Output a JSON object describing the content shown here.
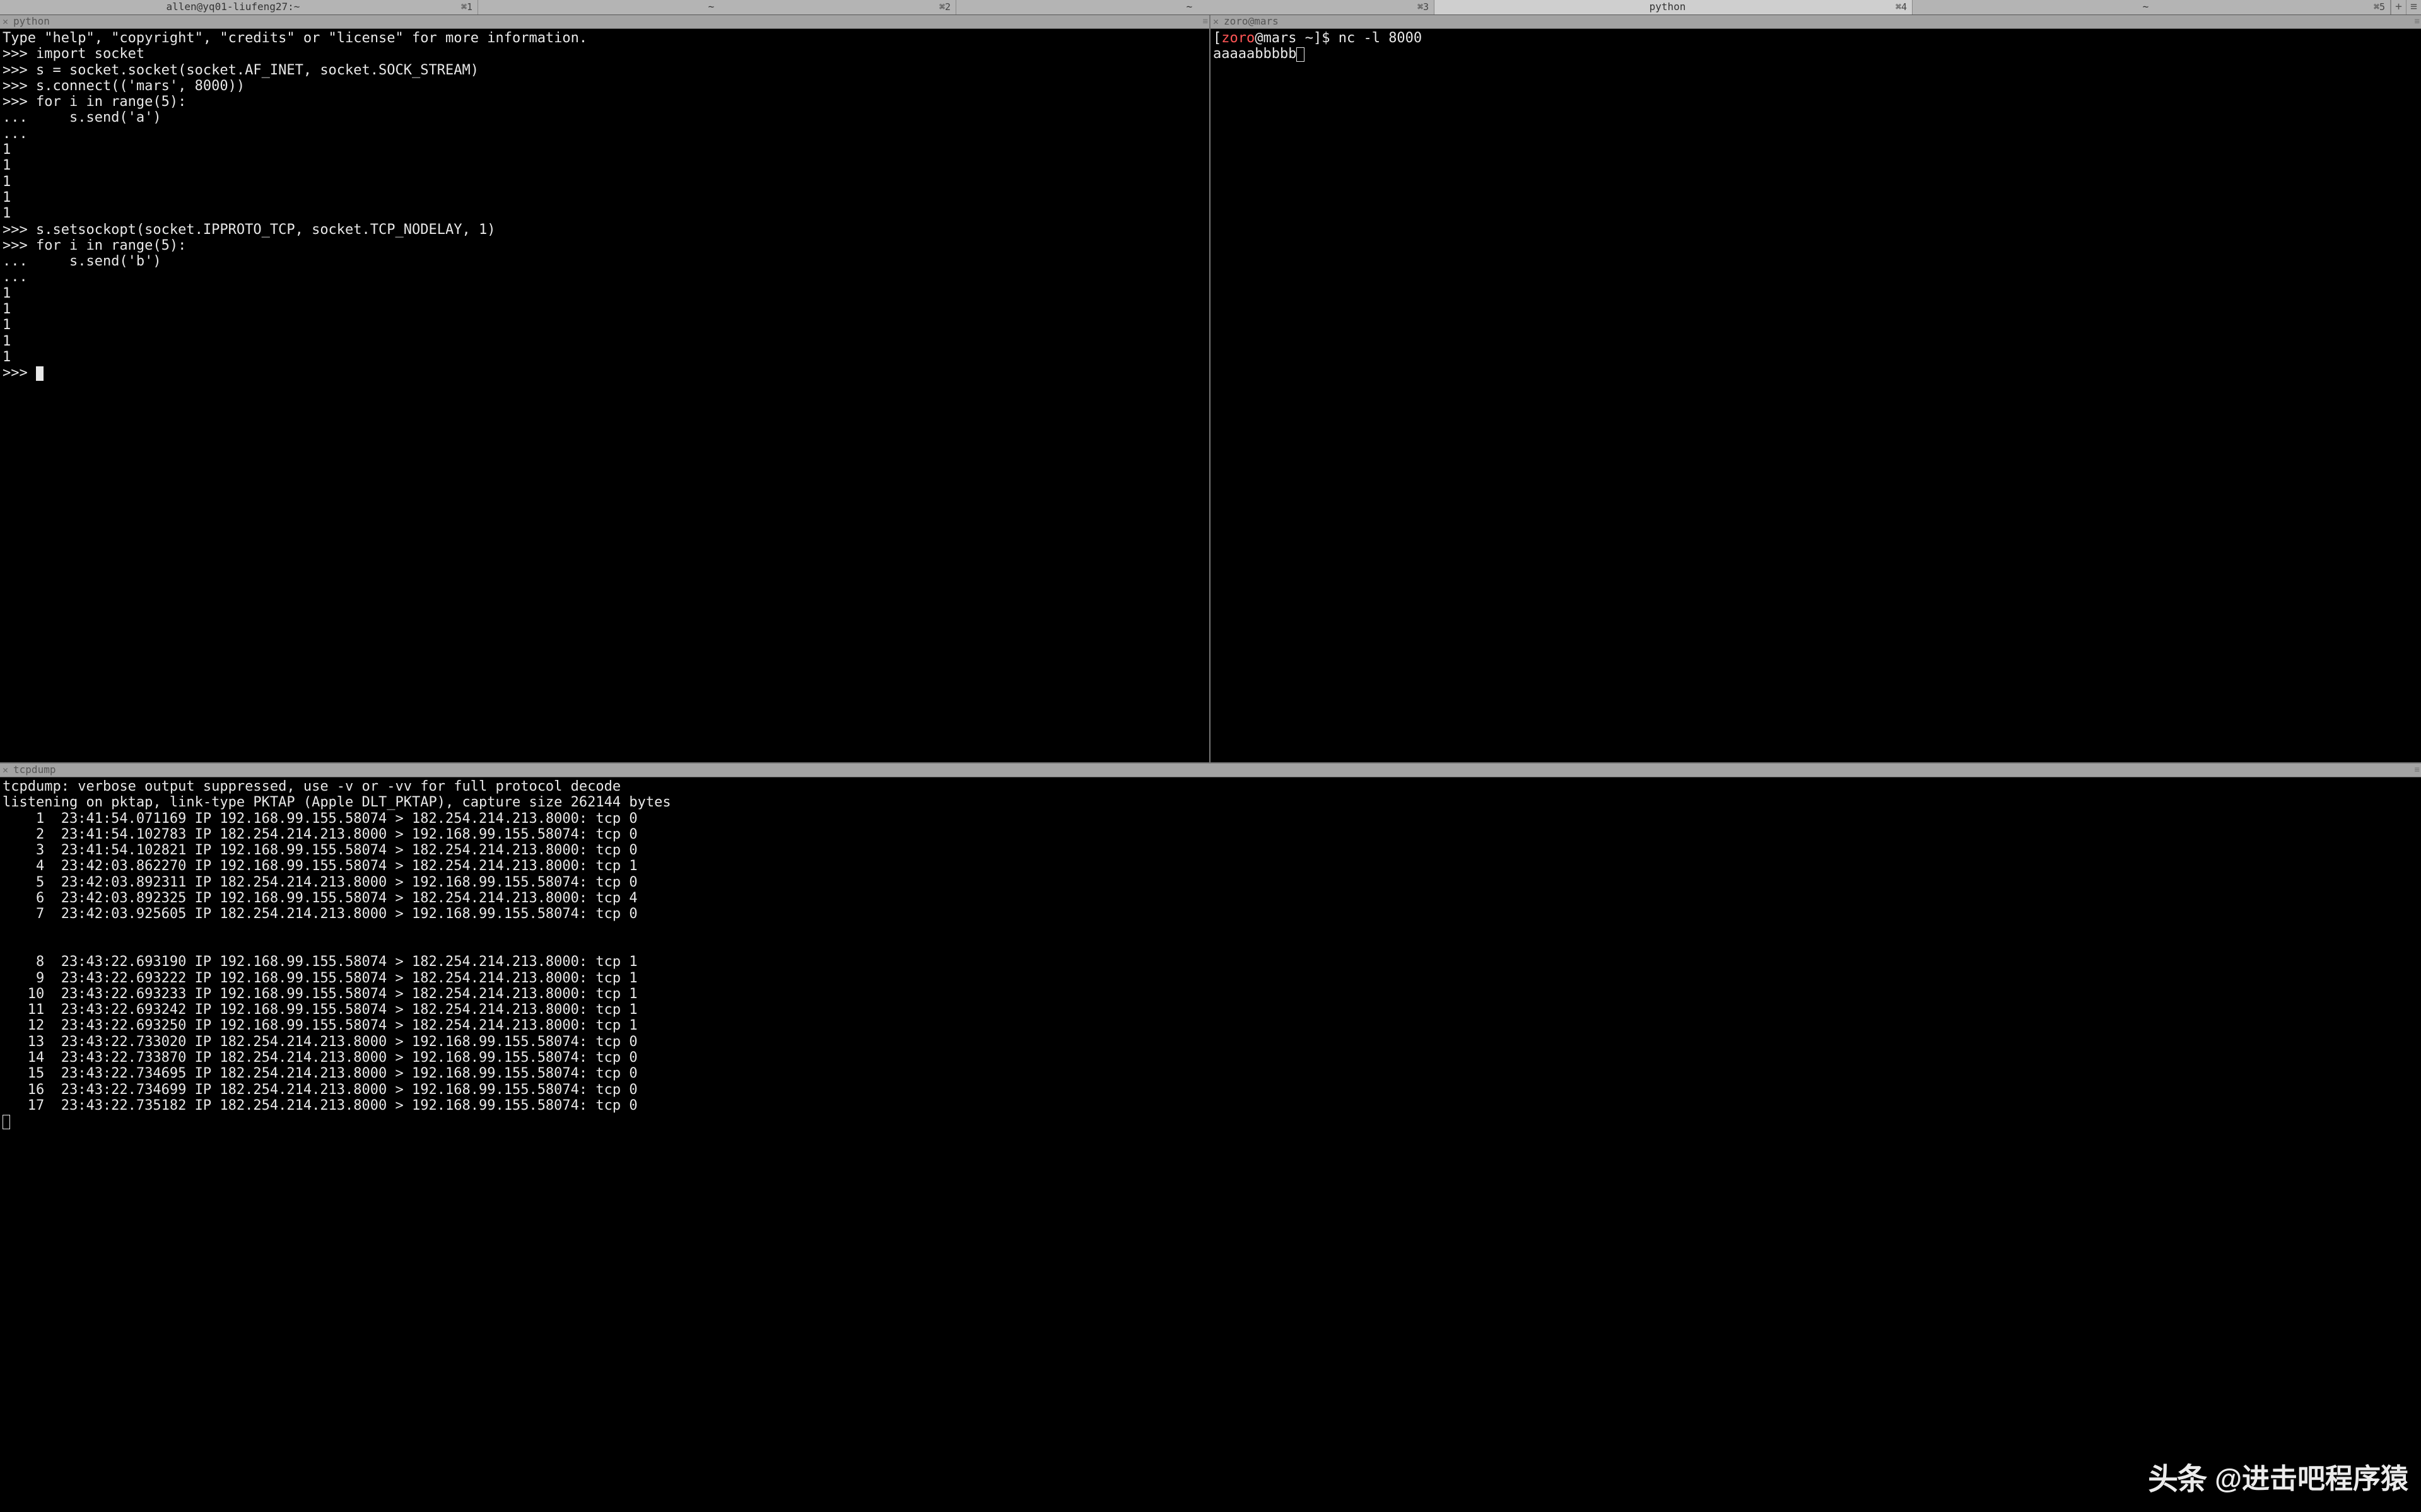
{
  "global_tabs": [
    {
      "title": "allen@yq01-liufeng27:~",
      "shortcut": "⌘1",
      "active": false
    },
    {
      "title": "~",
      "shortcut": "⌘2",
      "active": false
    },
    {
      "title": "~",
      "shortcut": "⌘3",
      "active": false
    },
    {
      "title": "python",
      "shortcut": "⌘4",
      "active": true
    },
    {
      "title": "~",
      "shortcut": "⌘5",
      "active": false
    }
  ],
  "pane_left": {
    "header_label": "python",
    "lines": [
      "Type \"help\", \"copyright\", \"credits\" or \"license\" for more information.",
      ">>> import socket",
      ">>> s = socket.socket(socket.AF_INET, socket.SOCK_STREAM)",
      ">>> s.connect(('mars', 8000))",
      ">>> for i in range(5):",
      "...     s.send('a')",
      "... ",
      "1",
      "1",
      "1",
      "1",
      "1",
      ">>> s.setsockopt(socket.IPPROTO_TCP, socket.TCP_NODELAY, 1)",
      ">>> for i in range(5):",
      "...     s.send('b')",
      "... ",
      "1",
      "1",
      "1",
      "1",
      "1",
      ">>> "
    ]
  },
  "pane_right": {
    "header_label": "zoro@mars",
    "prompt": {
      "user": "zoro",
      "host": "@mars",
      "path": " ~",
      "sep": "]$ "
    },
    "command": "nc -l 8000",
    "output": "aaaaabbbbb"
  },
  "pane_bottom": {
    "header_label": "tcpdump",
    "preamble": [
      "tcpdump: verbose output suppressed, use -v or -vv for full protocol decode",
      "listening on pktap, link-type PKTAP (Apple DLT_PKTAP), capture size 262144 bytes"
    ],
    "rows_a": [
      "    1  23:41:54.071169 IP 192.168.99.155.58074 > 182.254.214.213.8000: tcp 0",
      "    2  23:41:54.102783 IP 182.254.214.213.8000 > 192.168.99.155.58074: tcp 0",
      "    3  23:41:54.102821 IP 192.168.99.155.58074 > 182.254.214.213.8000: tcp 0",
      "    4  23:42:03.862270 IP 192.168.99.155.58074 > 182.254.214.213.8000: tcp 1",
      "    5  23:42:03.892311 IP 182.254.214.213.8000 > 192.168.99.155.58074: tcp 0",
      "    6  23:42:03.892325 IP 192.168.99.155.58074 > 182.254.214.213.8000: tcp 4",
      "    7  23:42:03.925605 IP 182.254.214.213.8000 > 192.168.99.155.58074: tcp 0"
    ],
    "rows_b": [
      "    8  23:43:22.693190 IP 192.168.99.155.58074 > 182.254.214.213.8000: tcp 1",
      "    9  23:43:22.693222 IP 192.168.99.155.58074 > 182.254.214.213.8000: tcp 1",
      "   10  23:43:22.693233 IP 192.168.99.155.58074 > 182.254.214.213.8000: tcp 1",
      "   11  23:43:22.693242 IP 192.168.99.155.58074 > 182.254.214.213.8000: tcp 1",
      "   12  23:43:22.693250 IP 192.168.99.155.58074 > 182.254.214.213.8000: tcp 1",
      "   13  23:43:22.733020 IP 182.254.214.213.8000 > 192.168.99.155.58074: tcp 0",
      "   14  23:43:22.733870 IP 182.254.214.213.8000 > 192.168.99.155.58074: tcp 0",
      "   15  23:43:22.734695 IP 182.254.214.213.8000 > 192.168.99.155.58074: tcp 0",
      "   16  23:43:22.734699 IP 182.254.214.213.8000 > 192.168.99.155.58074: tcp 0",
      "   17  23:43:22.735182 IP 182.254.214.213.8000 > 192.168.99.155.58074: tcp 0"
    ]
  },
  "watermark": {
    "logo": "头条",
    "text": "@进击吧程序猿"
  }
}
